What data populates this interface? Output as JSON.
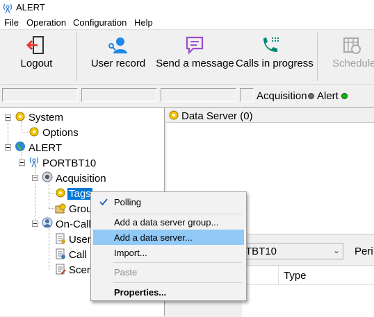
{
  "window": {
    "title": "ALERT"
  },
  "menu": [
    "File",
    "Operation",
    "Configuration",
    "Help"
  ],
  "toolbar": {
    "logout": "Logout",
    "user_record": "User record",
    "send_message": "Send a message",
    "calls_in_progress": "Calls in progress",
    "schedule": "Schedule"
  },
  "status": {
    "acquisition": "Acquisition",
    "alert": "Alert",
    "acquisition_color": "#6e6e6e",
    "alert_color": "#00c000"
  },
  "tree": {
    "system": "System",
    "options": "Options",
    "alert": "ALERT",
    "portbt10": "PORTBT10",
    "acquisition": "Acquisition",
    "tags": "Tags",
    "groups": "Grou",
    "oncall": "On-Call",
    "users": "User",
    "calls": "Call",
    "scenarios": "Scer"
  },
  "panel": {
    "data_server_title": "Data Server (0)",
    "combo_value": "TBT10",
    "period_label": "Peri",
    "column_type": "Type"
  },
  "context_menu": {
    "polling": "Polling",
    "add_group": "Add a data server group...",
    "add_server": "Add a data server...",
    "import": "Import...",
    "paste": "Paste",
    "properties": "Properties..."
  }
}
